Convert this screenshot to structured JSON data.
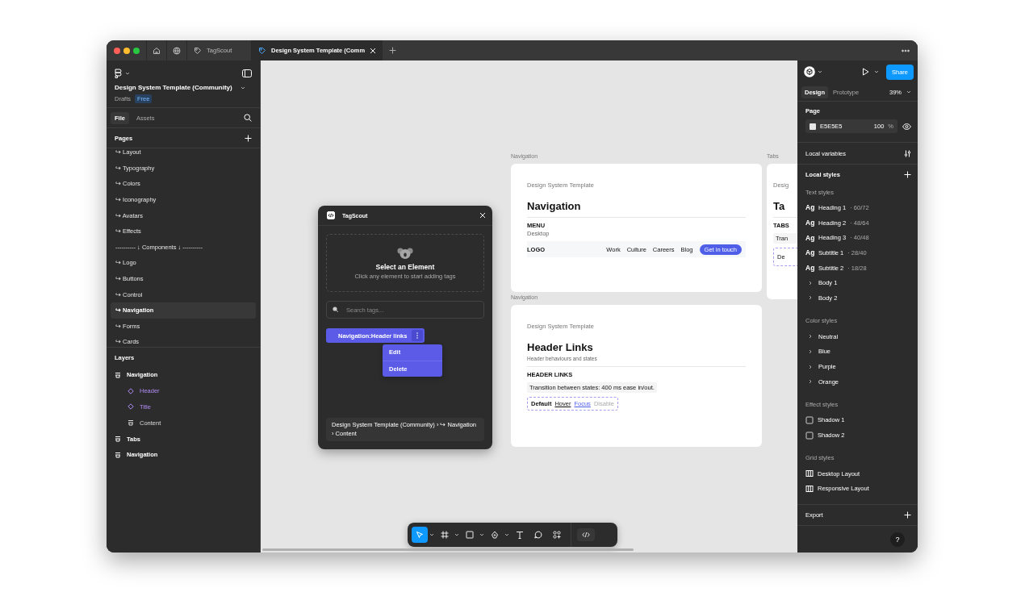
{
  "browser_tabs": [
    {
      "kind": "home",
      "selected": false
    },
    {
      "kind": "globe",
      "selected": false
    },
    {
      "kind": "plugin",
      "label": "TagScout",
      "selected": false
    },
    {
      "kind": "file",
      "label": "Design System Template (Comm",
      "selected": true
    }
  ],
  "sidebar": {
    "file_title": "Design System Template (Community)",
    "location": "Drafts",
    "plan_badge": "Free",
    "tabs": [
      {
        "label": "File",
        "selected": true
      },
      {
        "label": "Assets",
        "selected": false
      }
    ],
    "pages_heading": "Pages",
    "pages": [
      {
        "label": "↪ Layout",
        "selected": false
      },
      {
        "label": "↪ Typography",
        "selected": false
      },
      {
        "label": "↪ Colors",
        "selected": false
      },
      {
        "label": "↪ Iconography",
        "selected": false
      },
      {
        "label": "↪ Avatars",
        "selected": false
      },
      {
        "label": "↪ Effects",
        "selected": false
      },
      {
        "label": "---------- ↓ Components ↓ ----------",
        "selected": false
      },
      {
        "label": "↪ Logo",
        "selected": false
      },
      {
        "label": "↪ Buttons",
        "selected": false
      },
      {
        "label": "↪ Control",
        "selected": false
      },
      {
        "label": "↪ Navigation",
        "selected": true
      },
      {
        "label": "↪ Forms",
        "selected": false
      },
      {
        "label": "↪ Cards",
        "selected": false
      }
    ],
    "layers_heading": "Layers",
    "layers": [
      {
        "name": "Navigation",
        "kind": "frame",
        "children": [
          {
            "name": "Header",
            "kind": "component"
          },
          {
            "name": "Title",
            "kind": "component"
          },
          {
            "name": "Content",
            "kind": "frame"
          }
        ]
      },
      {
        "name": "Tabs",
        "kind": "frame"
      },
      {
        "name": "Navigation",
        "kind": "frame"
      }
    ]
  },
  "canvas": {
    "frames": [
      {
        "kind": "menu",
        "label": "Navigation",
        "eyebrow": "Design System Template",
        "title": "Navigation",
        "section": "MENU",
        "section_note": "Desktop",
        "logo": "LOGO",
        "links": [
          "Work",
          "Culture",
          "Careers",
          "Blog"
        ],
        "cta": "Get in touch"
      },
      {
        "kind": "links",
        "label": "Navigation",
        "eyebrow": "Design System Template",
        "title": "Header Links",
        "subtitle": "Header behaviours and states",
        "section": "HEADER LINKS",
        "note": "Transition between states: 400 ms ease in/out.",
        "states": [
          {
            "label": "Default",
            "kind": "default"
          },
          {
            "label": "Hover",
            "kind": "hover"
          },
          {
            "label": "Focus",
            "kind": "focus"
          },
          {
            "label": "Disable",
            "kind": "disabled"
          }
        ]
      },
      {
        "kind": "tabs",
        "label": "Tabs",
        "eyebrow": "Desig",
        "title": "Ta",
        "section": "TABS",
        "note": "Tran",
        "sample": "De"
      }
    ],
    "plugin": {
      "title": "TagScout",
      "empty_title": "Select an Element",
      "empty_hint": "Click any element to start adding tags",
      "search": {
        "placeholder": "Search tags..."
      },
      "tags": [
        {
          "label": "Navigation:Header links",
          "menu_open": true
        }
      ],
      "tag_menu": [
        "Edit",
        "Delete"
      ],
      "breadcrumb": "Design System Template (Community) › ↪ Navigation › Content"
    },
    "toolbar": {
      "tools": [
        {
          "kind": "move",
          "selected": true,
          "has_menu": true
        },
        {
          "kind": "frame",
          "selected": false,
          "has_menu": true
        },
        {
          "kind": "rectangle",
          "selected": false,
          "has_menu": true
        },
        {
          "kind": "pen",
          "selected": false,
          "has_menu": true
        },
        {
          "kind": "text",
          "selected": false,
          "has_menu": false
        },
        {
          "kind": "comment",
          "selected": false,
          "has_menu": false
        },
        {
          "kind": "actions",
          "selected": false,
          "has_menu": false
        }
      ],
      "dev_mode": false
    }
  },
  "right_panel": {
    "share": "Share",
    "tabs": [
      {
        "label": "Design",
        "selected": true
      },
      {
        "label": "Prototype",
        "selected": false
      }
    ],
    "zoom": "39%",
    "page": {
      "heading": "Page",
      "fill_hex": "E5E5E5",
      "opacity": "100",
      "unit": "%"
    },
    "local_variables": "Local variables",
    "local_styles": "Local styles",
    "style_groups": [
      {
        "heading": "Text styles",
        "items": [
          {
            "kind": "text_style",
            "sample": "Ag",
            "name": "Heading 1",
            "spec": "· 60/72"
          },
          {
            "kind": "text_style",
            "sample": "Ag",
            "name": "Heading 2",
            "spec": "· 48/64"
          },
          {
            "kind": "text_style",
            "sample": "Ag",
            "name": "Heading 3",
            "spec": "· 40/48"
          },
          {
            "kind": "text_style",
            "sample": "Ag",
            "name": "Subtitle 1",
            "spec": "· 28/40"
          },
          {
            "kind": "text_style",
            "sample": "Ag",
            "name": "Subtitle 2",
            "spec": "· 18/28"
          },
          {
            "kind": "folder",
            "name": "Body 1"
          },
          {
            "kind": "folder",
            "name": "Body 2"
          }
        ]
      },
      {
        "heading": "Color styles",
        "items": [
          {
            "kind": "folder",
            "name": "Neutral"
          },
          {
            "kind": "folder",
            "name": "Blue"
          },
          {
            "kind": "folder",
            "name": "Purple"
          },
          {
            "kind": "folder",
            "name": "Orange"
          }
        ]
      },
      {
        "heading": "Effect styles",
        "items": [
          {
            "kind": "effect",
            "name": "Shadow 1"
          },
          {
            "kind": "effect",
            "name": "Shadow 2"
          }
        ]
      },
      {
        "heading": "Grid styles",
        "items": [
          {
            "kind": "grid",
            "name": "Desktop Layout"
          },
          {
            "kind": "grid",
            "name": "Responsive Layout"
          }
        ]
      }
    ],
    "export": "Export",
    "help": "?"
  }
}
